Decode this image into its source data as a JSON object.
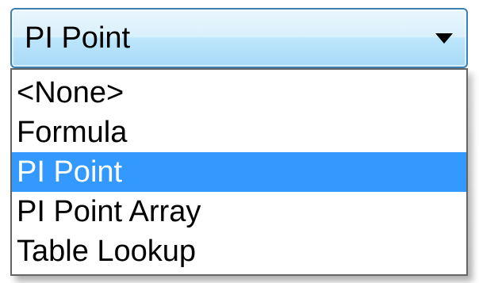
{
  "combo": {
    "value": "PI Point",
    "arrow_icon": "triangle-down-icon"
  },
  "dropdown": {
    "options": [
      {
        "label": "<None>",
        "selected": false
      },
      {
        "label": "Formula",
        "selected": false
      },
      {
        "label": "PI Point",
        "selected": true
      },
      {
        "label": "PI Point Array",
        "selected": false
      },
      {
        "label": "Table Lookup",
        "selected": false
      }
    ]
  },
  "colors": {
    "selection": "#3399ff",
    "combo_border": "#3c7fb1",
    "popup_border": "#646464"
  }
}
